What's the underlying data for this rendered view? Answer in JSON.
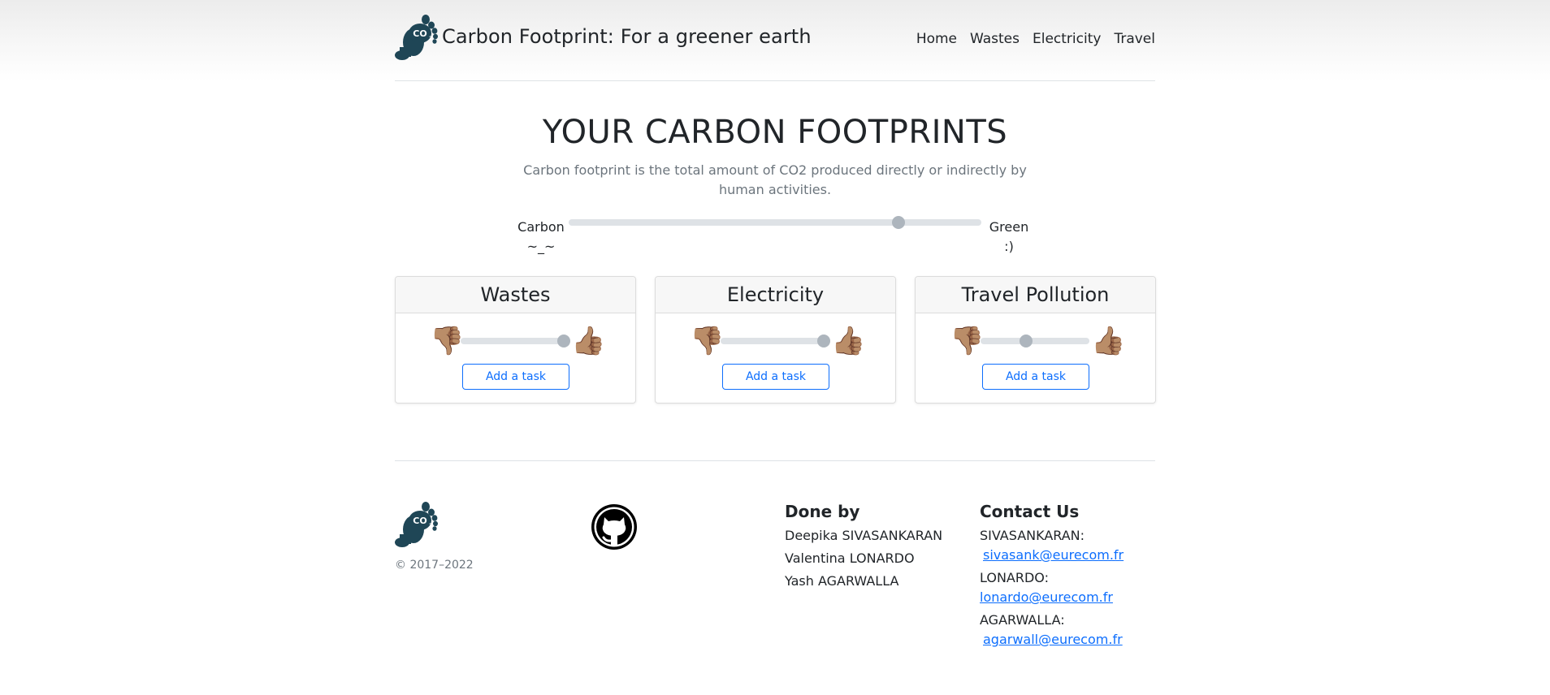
{
  "header": {
    "title": "Carbon Footprint: For a greener earth",
    "logo_icon": "co2-footprint-icon",
    "nav": [
      {
        "label": "Home"
      },
      {
        "label": "Wastes"
      },
      {
        "label": "Electricity"
      },
      {
        "label": "Travel"
      }
    ]
  },
  "hero": {
    "title": "YOUR CARBON FOOTPRINTS",
    "lead": "Carbon footprint is the total amount of CO2 produced directly or indirectly by human activities.",
    "scale": {
      "left_label_1": "Carbon",
      "left_label_2": "~_~",
      "right_label_1": "Green",
      "right_label_2": ":)",
      "value_fraction": 0.8
    }
  },
  "cards": [
    {
      "title": "Wastes",
      "button": "Add a task",
      "slider_fraction": 0.95
    },
    {
      "title": "Electricity",
      "button": "Add a task",
      "slider_fraction": 0.95
    },
    {
      "title": "Travel Pollution",
      "button": "Add a task",
      "slider_fraction": 0.42
    }
  ],
  "icons": {
    "thumbs_down": "👎🏽",
    "thumbs_up": "👍🏽"
  },
  "footer": {
    "copyright": "© 2017–2022",
    "github_icon": "github-icon",
    "done_by_title": "Done by",
    "members": [
      "Deepika SIVASANKARAN",
      "Valentina LONARDO",
      "Yash AGARWALLA"
    ],
    "contact_title": "Contact Us",
    "contacts": [
      {
        "name": "SIVASANKARAN:",
        "email": "sivasank@eurecom.fr"
      },
      {
        "name": "LONARDO:",
        "email": "lonardo@eurecom.fr"
      },
      {
        "name": "AGARWALLA:",
        "email": "agarwall@eurecom.fr"
      }
    ]
  }
}
